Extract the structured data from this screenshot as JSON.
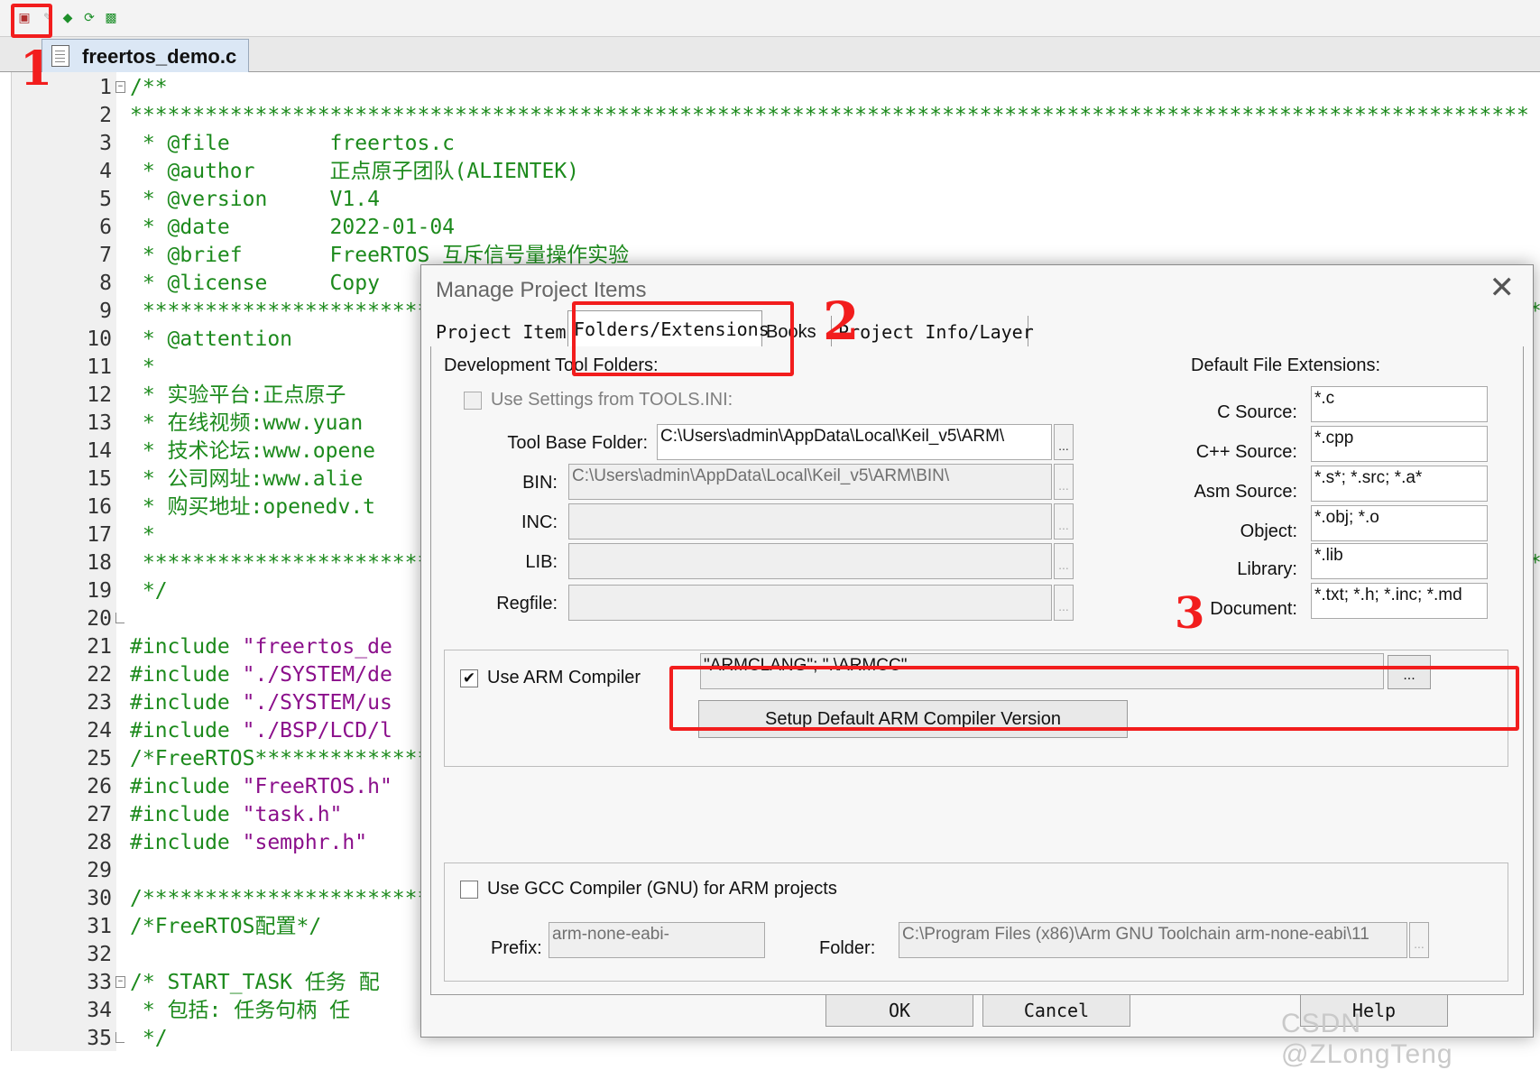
{
  "editor": {
    "file_tab": "freertos_demo.c",
    "lines": [
      {
        "n": "1",
        "fold": "−",
        "parts": [
          [
            "/**",
            "c-com"
          ]
        ]
      },
      {
        "n": "2",
        "parts": [
          [
            "****************************************************************************************************************",
            "c-com"
          ]
        ]
      },
      {
        "n": "3",
        "parts": [
          [
            " * @file        freertos.c",
            "c-com"
          ]
        ]
      },
      {
        "n": "4",
        "parts": [
          [
            " * @author      正点原子团队(ALIENTEK)",
            "c-com"
          ]
        ]
      },
      {
        "n": "5",
        "parts": [
          [
            " * @version     V1.4",
            "c-com"
          ]
        ]
      },
      {
        "n": "6",
        "parts": [
          [
            " * @date        2022-01-04",
            "c-com"
          ]
        ]
      },
      {
        "n": "7",
        "parts": [
          [
            " * @brief       FreeRTOS 互斥信号量操作实验",
            "c-com"
          ]
        ]
      },
      {
        "n": "8",
        "parts": [
          [
            " * @license     Copy",
            "c-com"
          ]
        ]
      },
      {
        "n": "9",
        "parts": [
          [
            " *****************************************************************************************************************",
            "c-com"
          ]
        ]
      },
      {
        "n": "10",
        "parts": [
          [
            " * @attention",
            "c-com"
          ]
        ]
      },
      {
        "n": "11",
        "parts": [
          [
            " *",
            "c-com"
          ]
        ]
      },
      {
        "n": "12",
        "parts": [
          [
            " * 实验平台:正点原子",
            "c-com"
          ]
        ]
      },
      {
        "n": "13",
        "parts": [
          [
            " * 在线视频:www.yuan",
            "c-com"
          ]
        ]
      },
      {
        "n": "14",
        "parts": [
          [
            " * 技术论坛:www.opene",
            "c-com"
          ]
        ]
      },
      {
        "n": "15",
        "parts": [
          [
            " * 公司网址:www.alie",
            "c-com"
          ]
        ]
      },
      {
        "n": "16",
        "parts": [
          [
            " * 购买地址:openedv.t",
            "c-com"
          ]
        ]
      },
      {
        "n": "17",
        "parts": [
          [
            " *",
            "c-com"
          ]
        ]
      },
      {
        "n": "18",
        "parts": [
          [
            " *****************************************************************************************************************",
            "c-com"
          ]
        ]
      },
      {
        "n": "19",
        "parts": [
          [
            " */",
            "c-com"
          ]
        ]
      },
      {
        "n": "20",
        "fold": "L",
        "parts": []
      },
      {
        "n": "21",
        "parts": [
          [
            "#include ",
            "c-pre"
          ],
          [
            "\"freertos_de",
            "c-str"
          ]
        ]
      },
      {
        "n": "22",
        "parts": [
          [
            "#include ",
            "c-pre"
          ],
          [
            "\"./SYSTEM/de",
            "c-str"
          ]
        ]
      },
      {
        "n": "23",
        "parts": [
          [
            "#include ",
            "c-pre"
          ],
          [
            "\"./SYSTEM/us",
            "c-str"
          ]
        ]
      },
      {
        "n": "24",
        "parts": [
          [
            "#include ",
            "c-pre"
          ],
          [
            "\"./BSP/LCD/l",
            "c-str"
          ]
        ]
      },
      {
        "n": "25",
        "parts": [
          [
            "/*FreeRTOS************************************************************************************************",
            "c-com"
          ]
        ]
      },
      {
        "n": "26",
        "parts": [
          [
            "#include ",
            "c-pre"
          ],
          [
            "\"FreeRTOS.h\"",
            "c-str"
          ]
        ]
      },
      {
        "n": "27",
        "parts": [
          [
            "#include ",
            "c-pre"
          ],
          [
            "\"task.h\"",
            "c-str"
          ]
        ]
      },
      {
        "n": "28",
        "parts": [
          [
            "#include ",
            "c-pre"
          ],
          [
            "\"semphr.h\"",
            "c-str"
          ]
        ]
      },
      {
        "n": "29",
        "parts": []
      },
      {
        "n": "30",
        "parts": [
          [
            "/**************************************************************************************************************",
            "c-com"
          ]
        ]
      },
      {
        "n": "31",
        "parts": [
          [
            "/*FreeRTOS配置*/",
            "c-com"
          ]
        ]
      },
      {
        "n": "32",
        "parts": []
      },
      {
        "n": "33",
        "fold": "−",
        "parts": [
          [
            "/* START_TASK 任务 配",
            "c-com"
          ]
        ]
      },
      {
        "n": "34",
        "parts": [
          [
            " * 包括: 任务句柄 任",
            "c-com"
          ]
        ]
      },
      {
        "n": "35",
        "fold": "L",
        "parts": [
          [
            " */",
            "c-com"
          ]
        ]
      }
    ]
  },
  "dialog": {
    "title": "Manage Project Items",
    "tabs": [
      "Project Items",
      "Folders/Extensions",
      "Books",
      "Project Info/Layer"
    ],
    "dev_tool_folders_label": "Development Tool Folders:",
    "use_tools_ini_label": "Use Settings from TOOLS.INI:",
    "tool_base_folder_label": "Tool Base Folder:",
    "tool_base_folder_value": "C:\\Users\\admin\\AppData\\Local\\Keil_v5\\ARM\\",
    "bin_label": "BIN:",
    "bin_value": "C:\\Users\\admin\\AppData\\Local\\Keil_v5\\ARM\\BIN\\",
    "inc_label": "INC:",
    "lib_label": "LIB:",
    "regfile_label": "Regfile:",
    "browse_label": "...",
    "default_ext_label": "Default File Extensions:",
    "c_source_label": "C Source:",
    "c_source_value": "*.c",
    "cpp_source_label": "C++ Source:",
    "cpp_source_value": "*.cpp",
    "asm_source_label": "Asm Source:",
    "asm_source_value": "*.s*; *.src; *.a*",
    "object_label": "Object:",
    "object_value": "*.obj; *.o",
    "library_label": "Library:",
    "library_value": "*.lib",
    "document_label": "Document:",
    "document_value": "*.txt; *.h; *.inc; *.md",
    "use_arm_compiler_label": "Use ARM Compiler",
    "use_arm_compiler_check": "✔",
    "arm_compiler_value": "\"ARMCLANG\"; \".\\ARMCC\"",
    "setup_default_arm_label": "Setup Default ARM Compiler Version",
    "use_gcc_label": "Use GCC Compiler (GNU) for ARM projects",
    "prefix_label": "Prefix:",
    "prefix_value": "arm-none-eabi-",
    "folder_label": "Folder:",
    "folder_value": "C:\\Program Files (x86)\\Arm GNU Toolchain arm-none-eabi\\11",
    "ok_label": "OK",
    "cancel_label": "Cancel",
    "help_label": "Help"
  },
  "annotations": {
    "mark1": "1",
    "mark2": "2",
    "mark3": "3"
  },
  "watermark": "CSDN @ZLongTeng",
  "colors": {
    "annotation_red": "#f21d1d",
    "comment_green": "#1c8a1c",
    "string_purple": "#8b0f8b"
  }
}
